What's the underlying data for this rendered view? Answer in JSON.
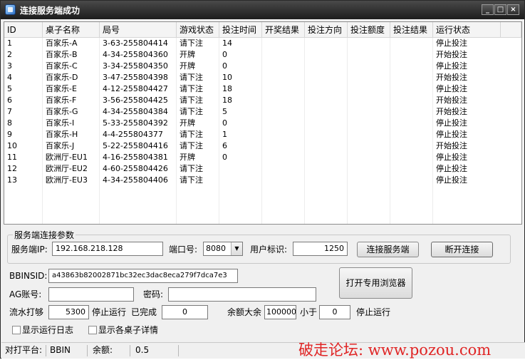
{
  "window": {
    "title": "连接服务端成功"
  },
  "table": {
    "columns": [
      "ID",
      "桌子名称",
      "局号",
      "游戏状态",
      "投注时间",
      "开奖结果",
      "投注方向",
      "投注额度",
      "投注结果",
      "运行状态"
    ],
    "rows": [
      [
        "1",
        "百家乐-A",
        "3-63-255804414",
        "请下注",
        "14",
        "",
        "",
        "",
        "",
        "停止投注"
      ],
      [
        "2",
        "百家乐-B",
        "4-34-255804360",
        "开牌",
        "0",
        "",
        "",
        "",
        "",
        "开始投注"
      ],
      [
        "3",
        "百家乐-C",
        "3-34-255804350",
        "开牌",
        "0",
        "",
        "",
        "",
        "",
        "停止投注"
      ],
      [
        "4",
        "百家乐-D",
        "3-47-255804398",
        "请下注",
        "10",
        "",
        "",
        "",
        "",
        "开始投注"
      ],
      [
        "5",
        "百家乐-E",
        "4-12-255804427",
        "请下注",
        "18",
        "",
        "",
        "",
        "",
        "停止投注"
      ],
      [
        "6",
        "百家乐-F",
        "3-56-255804425",
        "请下注",
        "18",
        "",
        "",
        "",
        "",
        "开始投注"
      ],
      [
        "7",
        "百家乐-G",
        "4-34-255804384",
        "请下注",
        "5",
        "",
        "",
        "",
        "",
        "开始投注"
      ],
      [
        "8",
        "百家乐-I",
        "5-33-255804392",
        "开牌",
        "0",
        "",
        "",
        "",
        "",
        "停止投注"
      ],
      [
        "9",
        "百家乐-H",
        "4-4-255804377",
        "请下注",
        "1",
        "",
        "",
        "",
        "",
        "停止投注"
      ],
      [
        "10",
        "百家乐-J",
        "5-22-255804416",
        "请下注",
        "6",
        "",
        "",
        "",
        "",
        "开始投注"
      ],
      [
        "11",
        "欧洲厅-EU1",
        "4-16-255804381",
        "开牌",
        "0",
        "",
        "",
        "",
        "",
        "停止投注"
      ],
      [
        "12",
        "欧洲厅-EU2",
        "4-60-255804426",
        "请下注",
        "",
        "",
        "",
        "",
        "",
        "停止投注"
      ],
      [
        "13",
        "欧洲厅-EU3",
        "4-34-255804406",
        "请下注",
        "",
        "",
        "",
        "",
        "",
        "停止投注"
      ]
    ]
  },
  "server": {
    "group_title": "服务端连接参数",
    "ip_label": "服务端IP:",
    "ip": "192.168.218.128",
    "port_label": "端口号:",
    "port": "8080",
    "user_label": "用户标识:",
    "user_id": "1250",
    "connect_button": "连接服务端",
    "disconnect_button": "断开连接"
  },
  "account": {
    "bbinsid_label": "BBINSID:",
    "bbinsid": "a43863b82002871bc32ec3dac8eca279f7dca7e3",
    "ag_label": "AG账号:",
    "ag_value": "",
    "password_label": "密码:",
    "password_value": "",
    "browser_button": "打开专用浏览器"
  },
  "run": {
    "flow_label": "流水打够",
    "flow_value": "5300",
    "stop_label": "停止运行",
    "done_label": "已完成",
    "done_value": "0",
    "balance_label": "余额大余",
    "balance_value": "100000",
    "less_label": "小于",
    "less_value": "0",
    "stop_label2": "停止运行"
  },
  "options": {
    "show_log": "显示运行日志",
    "show_tables": "显示各桌子详情"
  },
  "status_bar": {
    "platform_label": "对打平台:",
    "platform": "BBIN",
    "balance_label": "余额:",
    "balance": "0.5"
  },
  "watermark": "破走论坛:  www.pozou.com"
}
